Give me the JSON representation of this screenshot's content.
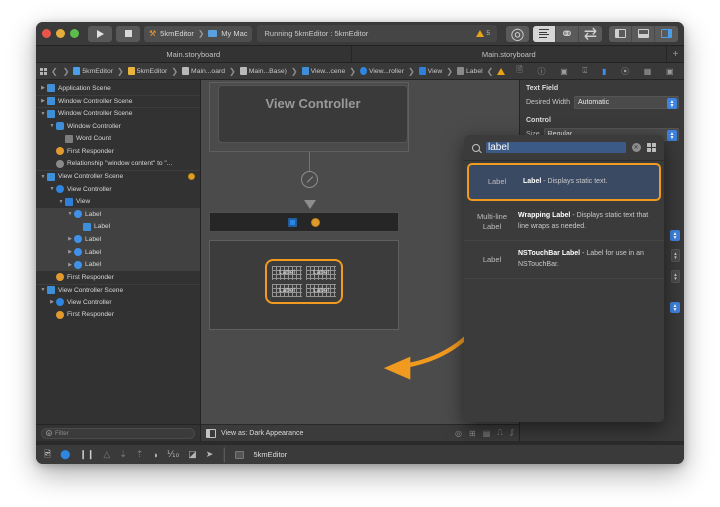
{
  "window": {
    "traffic_lights": [
      "close",
      "minimize",
      "zoom"
    ],
    "scheme_target": "5kmEditor",
    "scheme_device": "My Mac",
    "status_text": "Running 5kmEditor : 5kmEditor",
    "warning_count": "5"
  },
  "tabs": [
    {
      "label": "Main.storyboard"
    },
    {
      "label": "Main.storyboard"
    }
  ],
  "tab_add_label": "+",
  "breadcrumb": [
    {
      "label": "5kmEditor",
      "icon": "project-icon"
    },
    {
      "label": "5kmEditor",
      "icon": "folder-icon"
    },
    {
      "label": "Main...oard",
      "icon": "storyboard-icon"
    },
    {
      "label": "Main...Base)",
      "icon": "storyboard-icon"
    },
    {
      "label": "View...cene",
      "icon": "scene-icon"
    },
    {
      "label": "View...roller",
      "icon": "viewcontroller-icon"
    },
    {
      "label": "View",
      "icon": "view-icon"
    },
    {
      "label": "Label",
      "icon": "label-icon"
    }
  ],
  "navigator": {
    "rows": [
      {
        "label": "Application Scene",
        "indent": 0,
        "disclosure": "collapsed",
        "icon": "scene",
        "divider": false
      },
      {
        "label": "Window Controller Scene",
        "indent": 0,
        "disclosure": "collapsed",
        "icon": "scene",
        "divider": true
      },
      {
        "label": "Window Controller Scene",
        "indent": 0,
        "disclosure": "expanded",
        "icon": "scene",
        "divider": true
      },
      {
        "label": "Window Controller",
        "indent": 1,
        "disclosure": "expanded",
        "icon": "winctl",
        "divider": false
      },
      {
        "label": "Word Count",
        "indent": 2,
        "disclosure": "none",
        "icon": "wordc",
        "divider": false
      },
      {
        "label": "First Responder",
        "indent": 1,
        "disclosure": "none",
        "icon": "fr",
        "divider": false
      },
      {
        "label": "Relationship \"window content\" to \"...",
        "indent": 1,
        "disclosure": "none",
        "icon": "rel",
        "divider": false
      },
      {
        "label": "View Controller Scene",
        "indent": 0,
        "disclosure": "expanded",
        "icon": "scene",
        "divider": true,
        "badge": "runtime-issue"
      },
      {
        "label": "View Controller",
        "indent": 1,
        "disclosure": "expanded",
        "icon": "vc",
        "divider": false
      },
      {
        "label": "View",
        "indent": 2,
        "disclosure": "expanded",
        "icon": "view",
        "divider": false
      },
      {
        "label": "Label",
        "indent": 3,
        "disclosure": "expanded",
        "icon": "label",
        "divider": false,
        "selected": true
      },
      {
        "label": "Label",
        "indent": 4,
        "disclosure": "none",
        "icon": "lblbox",
        "divider": false,
        "selected": true
      },
      {
        "label": "Label",
        "indent": 3,
        "disclosure": "collapsed",
        "icon": "label",
        "divider": false,
        "selected": true
      },
      {
        "label": "Label",
        "indent": 3,
        "disclosure": "collapsed",
        "icon": "label",
        "divider": false,
        "selected": true
      },
      {
        "label": "Label",
        "indent": 3,
        "disclosure": "collapsed",
        "icon": "label",
        "divider": false,
        "selected": true
      },
      {
        "label": "First Responder",
        "indent": 1,
        "disclosure": "none",
        "icon": "fr",
        "divider": false
      },
      {
        "label": "View Controller Scene",
        "indent": 0,
        "disclosure": "expanded",
        "icon": "scene",
        "divider": true
      },
      {
        "label": "View Controller",
        "indent": 1,
        "disclosure": "collapsed",
        "icon": "vc",
        "divider": false
      },
      {
        "label": "First Responder",
        "indent": 1,
        "disclosure": "none",
        "icon": "fr",
        "divider": false
      }
    ],
    "filter_placeholder": "Filter"
  },
  "canvas": {
    "view_controller_title": "View Controller",
    "mini_labels": [
      "Label",
      "Label",
      "Label",
      "Label"
    ],
    "view_as_label": "View as: Dark Appearance"
  },
  "inspector": {
    "sections": [
      {
        "title": "Text Field",
        "rows": [
          {
            "label": "Desired Width",
            "value": "Automatic"
          }
        ]
      },
      {
        "title": "Control",
        "rows": [
          {
            "label": "Size",
            "value": "Regular"
          }
        ]
      }
    ]
  },
  "library": {
    "search_query": "label",
    "items": [
      {
        "thumb": "Label",
        "title": "Label",
        "desc": " - Displays static text.",
        "selected": true
      },
      {
        "thumb": "Multi-line Label",
        "title": "Wrapping Label",
        "desc": " - Displays static text that line wraps as needed.",
        "selected": false
      },
      {
        "thumb": "Label",
        "title": "NSTouchBar Label",
        "desc": " - Label for use in an NSTouchBar.",
        "selected": false
      }
    ]
  },
  "status_bar": {
    "project_name": "5kmEditor"
  },
  "colors": {
    "accent_orange": "#f09a20",
    "accent_blue": "#3e83e0",
    "selection_blue": "#3a4a63",
    "warning_yellow": "#e8a317"
  }
}
